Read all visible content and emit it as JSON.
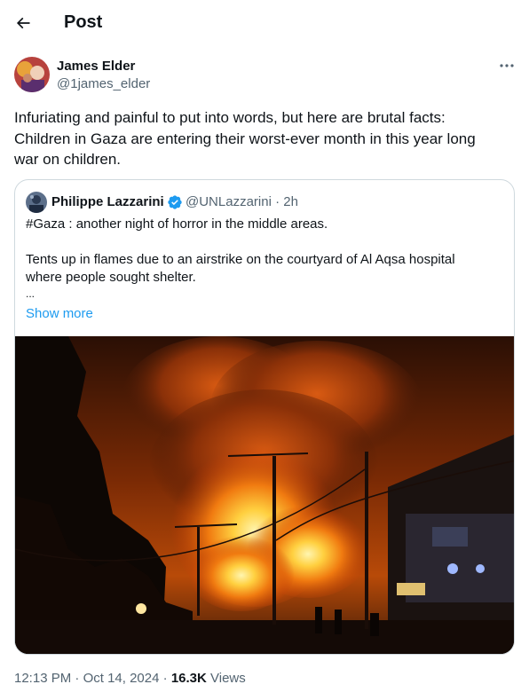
{
  "header": {
    "title": "Post"
  },
  "author": {
    "name": "James Elder",
    "handle": "@1james_elder"
  },
  "post": {
    "lines": [
      "Infuriating and painful to put into words, but here are brutal facts:",
      "Children in Gaza are entering their worst-ever month in this year long",
      "war on children."
    ]
  },
  "quote": {
    "name": "Philippe Lazzarini",
    "handle": "@UNLazzarini",
    "separator": "·",
    "time": "2h",
    "line1": "#Gaza : another night of horror in the middle areas.",
    "line2": "Tents up in flames due to an airstrike on the courtyard of Al Aqsa hospital",
    "line3": "where people sought shelter.",
    "ellipsis": "...",
    "show_more": "Show more"
  },
  "meta": {
    "time": "12:13 PM",
    "sep1": "·",
    "date": "Oct 14, 2024",
    "sep2": "·",
    "views_count": "16.3K",
    "views_label": "Views"
  },
  "colors": {
    "accent": "#1d9bf0",
    "secondary_text": "#536471",
    "border": "#cfd9de"
  },
  "icons": {
    "back": "arrow-left-icon",
    "more": "more-horizontal-icon",
    "verified": "verified-badge-icon"
  }
}
